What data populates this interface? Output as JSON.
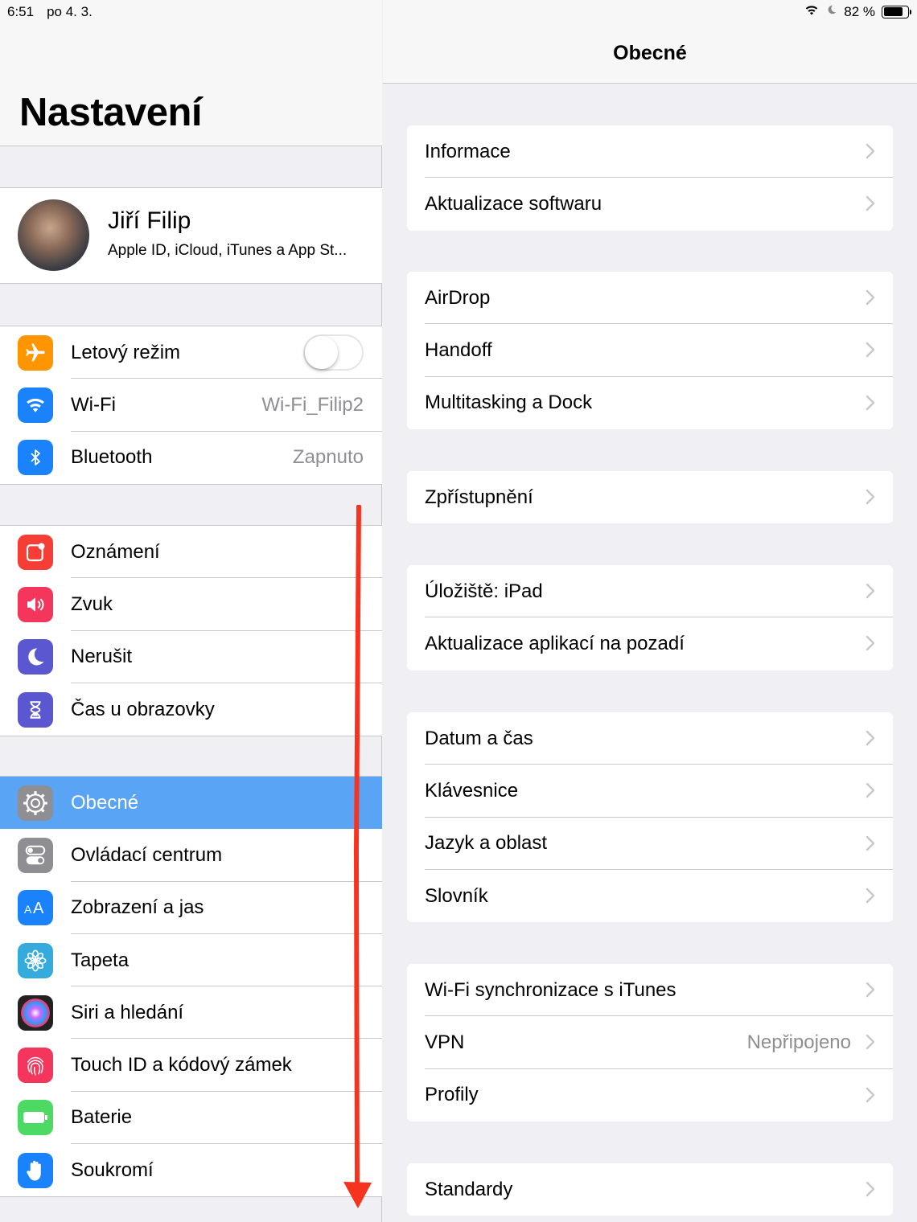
{
  "status_bar": {
    "time": "6:51",
    "date": "po 4. 3.",
    "battery_percent": "82 %",
    "battery_level": 0.82
  },
  "left": {
    "title": "Nastavení",
    "profile": {
      "name": "Jiří Filip",
      "subtitle": "Apple ID, iCloud, iTunes a App St..."
    },
    "group1": [
      {
        "label": "Letový režim",
        "icon": "airplane-icon",
        "color": "#ff9500",
        "toggle": false
      },
      {
        "label": "Wi-Fi",
        "icon": "wifi-icon",
        "color": "#1a82fb",
        "value": "Wi-Fi_Filip2"
      },
      {
        "label": "Bluetooth",
        "icon": "bluetooth-icon",
        "color": "#1a82fb",
        "value": "Zapnuto"
      }
    ],
    "group2": [
      {
        "label": "Oznámení",
        "icon": "notifications-icon",
        "color": "#f63e36"
      },
      {
        "label": "Zvuk",
        "icon": "sound-icon",
        "color": "#f5365c"
      },
      {
        "label": "Nerušit",
        "icon": "moon-icon",
        "color": "#5b57d1"
      },
      {
        "label": "Čas u obrazovky",
        "icon": "hourglass-icon",
        "color": "#5b57d1"
      }
    ],
    "group3": [
      {
        "label": "Obecné",
        "icon": "gear-icon",
        "color": "#8e8e93",
        "selected": true
      },
      {
        "label": "Ovládací centrum",
        "icon": "switches-icon",
        "color": "#8e8e93"
      },
      {
        "label": "Zobrazení a jas",
        "icon": "text-size-icon",
        "color": "#1a82fb"
      },
      {
        "label": "Tapeta",
        "icon": "flower-icon",
        "color": "#35aadc"
      },
      {
        "label": "Siri a hledání",
        "icon": "siri-icon",
        "color": "#222222"
      },
      {
        "label": "Touch ID a kódový zámek",
        "icon": "fingerprint-icon",
        "color": "#f5365c"
      },
      {
        "label": "Baterie",
        "icon": "battery-icon",
        "color": "#4cd964"
      },
      {
        "label": "Soukromí",
        "icon": "hand-icon",
        "color": "#1a82fb"
      }
    ]
  },
  "right": {
    "title": "Obecné",
    "groups": [
      [
        {
          "label": "Informace"
        },
        {
          "label": "Aktualizace softwaru"
        }
      ],
      [
        {
          "label": "AirDrop"
        },
        {
          "label": "Handoff"
        },
        {
          "label": "Multitasking a Dock"
        }
      ],
      [
        {
          "label": "Zpřístupnění"
        }
      ],
      [
        {
          "label": "Úložiště: iPad"
        },
        {
          "label": "Aktualizace aplikací na pozadí"
        }
      ],
      [
        {
          "label": "Datum a čas"
        },
        {
          "label": "Klávesnice"
        },
        {
          "label": "Jazyk a oblast"
        },
        {
          "label": "Slovník"
        }
      ],
      [
        {
          "label": "Wi-Fi synchronizace s iTunes"
        },
        {
          "label": "VPN",
          "value": "Nepřipojeno"
        },
        {
          "label": "Profily"
        }
      ],
      [
        {
          "label": "Standardy"
        }
      ]
    ]
  },
  "annotation_color": "#f5331f"
}
